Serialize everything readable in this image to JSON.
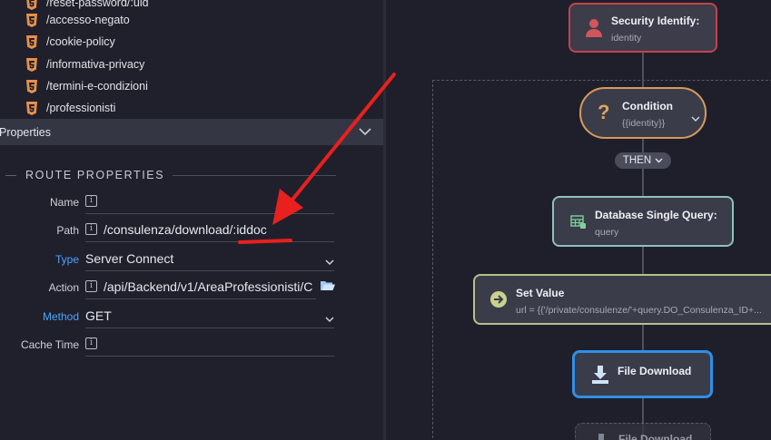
{
  "files": [
    {
      "label": "/reset-password/:uid"
    },
    {
      "label": "/accesso-negato"
    },
    {
      "label": "/cookie-policy"
    },
    {
      "label": "/informativa-privacy"
    },
    {
      "label": "/termini-e-condizioni"
    },
    {
      "label": "/professionisti"
    }
  ],
  "properties_header": "Properties",
  "route_section_title": "ROUTE PROPERTIES",
  "route": {
    "name_label": "Name",
    "name_value": "",
    "path_label": "Path",
    "path_value": "/consulenza/download/:iddoc",
    "type_label": "Type",
    "type_value": "Server Connect",
    "action_label": "Action",
    "action_value": "/api/Backend/v1/AreaProfessionisti/C",
    "method_label": "Method",
    "method_value": "GET",
    "cache_label": "Cache Time",
    "cache_value": ""
  },
  "flow": {
    "security": {
      "title": "Security Identify:",
      "sub": "identity"
    },
    "condition": {
      "title": "Condition",
      "sub": "{{identity}}"
    },
    "then_label": "THEN",
    "db_query": {
      "title": "Database Single Query:",
      "sub": "query"
    },
    "set_value": {
      "title": "Set Value",
      "sub": "url = {{'/private/consulenze/'+query.DO_Consulenza_ID+..."
    },
    "file_download": {
      "title": "File Download"
    },
    "file_download_2": {
      "title": "File Download"
    }
  },
  "colors": {
    "accent": "#4da3ff",
    "security_border": "#c2444a",
    "condition_border": "#d69a5c",
    "db_border": "#8fc1bb",
    "setvalue_border": "#b8c08a",
    "download_border": "#2f8fe6",
    "annotation": "#e8201e"
  }
}
